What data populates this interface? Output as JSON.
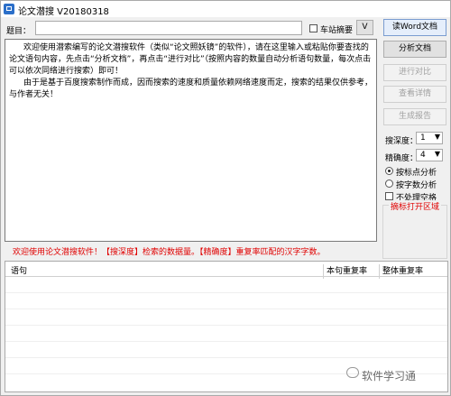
{
  "window": {
    "title": "论文潜搜 V20180318"
  },
  "top_bar": {
    "title_label": "题目：",
    "title_value": "",
    "chk_label": "车站摘要",
    "v_label": "V"
  },
  "buttons": {
    "read_word": "读Word文档",
    "analyze": "分析文档",
    "compare": "进行对比",
    "details": "查看详情",
    "report": "生成报告"
  },
  "options": {
    "depth_label": "搜深度：",
    "depth_value": "1",
    "precision_label": "精确度：",
    "precision_value": "4",
    "radio_punct": "按标点分析",
    "radio_count": "按字数分析",
    "chk_space": "不处理空格",
    "group_title": "摘标打开区域"
  },
  "editor": {
    "para1": "欢迎使用潜索编写的论文潜搜软件（类似“论文照妖镜”的软件），请在这里输入或粘贴你要查找的论文语句内容，先点击“分析文档”，再点击“进行对比”（按照内容的数量自动分析语句数量，每次点击可以依次同络进行搜索）即可！",
    "para2": "由于是基于百度搜索制作而成，因而搜索的速度和质量依赖网络速度而定，搜索的结果仅供参考，与作者无关！"
  },
  "status": "欢迎使用论文潜搜软件！【搜深度】检索的数据量。【精确度】重复率匹配的汉字字数。",
  "table": {
    "col_sentence": "语句",
    "col_sentence_rate": "本句重复率",
    "col_overall_rate": "整体重复率"
  },
  "watermark": "软件学习通"
}
